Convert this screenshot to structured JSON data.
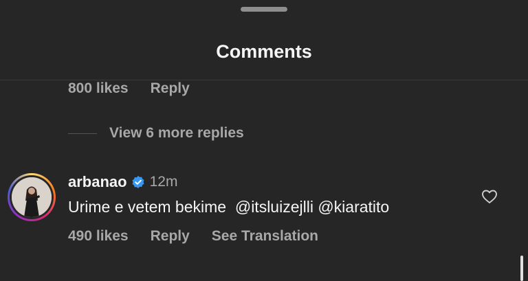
{
  "header": {
    "title": "Comments"
  },
  "previous_comment": {
    "likes": "800 likes",
    "reply": "Reply"
  },
  "replies": {
    "view_more": "View 6 more replies"
  },
  "comment": {
    "username": "arbanao",
    "time": "12m",
    "text": "Urime e vetem bekime  @itsluizejlli @kiaratito",
    "likes": "490 likes",
    "reply": "Reply",
    "translate": "See Translation"
  },
  "colors": {
    "background": "#262626",
    "muted_text": "#a8a8a8",
    "verified_blue": "#3897f0"
  }
}
